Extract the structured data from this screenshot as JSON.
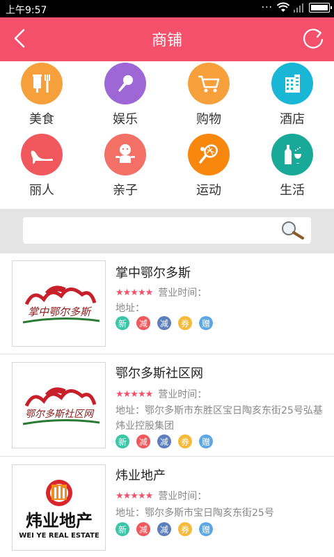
{
  "status": {
    "time": "上午9:57",
    "dots": "···"
  },
  "header": {
    "title": "商铺"
  },
  "categories": [
    {
      "label": "美食",
      "icon": "food-icon",
      "color": "#f7a03b"
    },
    {
      "label": "娱乐",
      "icon": "microphone-icon",
      "color": "#9d67d6"
    },
    {
      "label": "购物",
      "icon": "cart-icon",
      "color": "#f7a03b"
    },
    {
      "label": "酒店",
      "icon": "hotel-icon",
      "color": "#1ab6d6"
    },
    {
      "label": "丽人",
      "icon": "high-heel-icon",
      "color": "#f0585d"
    },
    {
      "label": "亲子",
      "icon": "baby-icon",
      "color": "#f27065"
    },
    {
      "label": "运动",
      "icon": "tennis-icon",
      "color": "#f7870d"
    },
    {
      "label": "生活",
      "icon": "wine-icon",
      "color": "#19a998"
    }
  ],
  "search": {
    "placeholder": ""
  },
  "tag_colors": [
    "#3cc6a8",
    "#f0585d",
    "#5e7fbf",
    "#f7b938",
    "#5ea7e6"
  ],
  "shops": [
    {
      "name": "掌中鄂尔多斯",
      "stars": "★★★★★",
      "hours": "营业时间：",
      "address": "地址：",
      "logo_text": "掌中鄂尔多斯",
      "tags": [
        "新",
        "减",
        "减",
        "券",
        "赠"
      ]
    },
    {
      "name": "鄂尔多斯社区网",
      "stars": "★★★★★",
      "hours": "营业时间：",
      "address": "地址：鄂尔多斯市东胜区宝日陶亥东街25号弘基炜业控股集团",
      "logo_text": "鄂尔多斯社区网",
      "tags": [
        "新",
        "减",
        "减",
        "券",
        "赠"
      ]
    },
    {
      "name": "炜业地产",
      "stars": "★★★★★",
      "hours": "营业时间：",
      "address": "地址：鄂尔多斯市宝日陶亥东街25号",
      "logo_text": "炜业地产",
      "logo_subtext": "WEI YE REAL ESTATE",
      "tags": [
        "新",
        "减",
        "减",
        "券",
        "赠"
      ]
    }
  ]
}
